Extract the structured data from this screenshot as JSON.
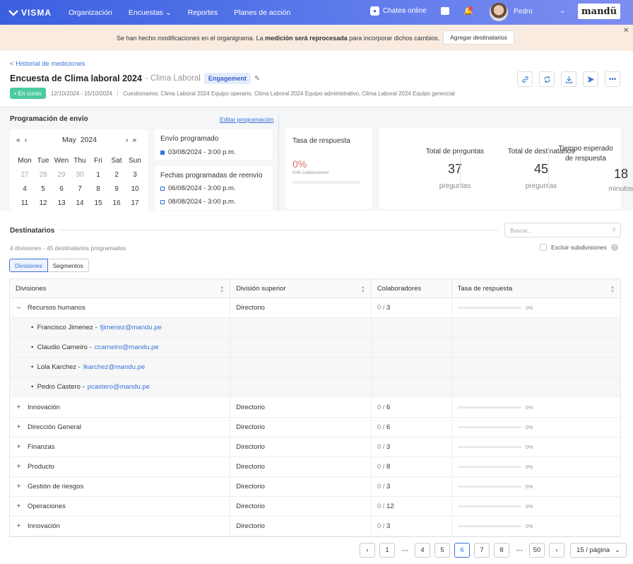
{
  "topbar": {
    "logo": "VISMA",
    "nav": [
      "Organización",
      "Encuestas",
      "Reportes",
      "Planes de acción"
    ],
    "chat_label": "Chatea online",
    "user_name": "Pedro",
    "brand": "mandü"
  },
  "banner": {
    "text_before": "Se han hecho modificaciones en el organigrama. La ",
    "text_bold": "medición será reprocesada",
    "text_after": " para incorporar dichos cambios.",
    "button": "Agregar destinatarios"
  },
  "header": {
    "back_link": "< Historial de mediciones",
    "title": "Encuesta de Clima laboral 2024",
    "subtitle": "- Clima Laboral",
    "tag": "Engagement",
    "status": "• En curso",
    "dates": "12/10/2024 - 15/10/2024",
    "cuestionarios": "Cuestionarios: Clima Laboral 2024 Equipo operario, Clima Laboral 2024 Equipo administrativo, Clima Laboral 2024 Equipo gerencial"
  },
  "programacion": {
    "title": "Programación de envío",
    "edit_link": "Editar programación",
    "calendar": {
      "month": "May",
      "year": "2024",
      "weekdays": [
        "Mon",
        "Tue",
        "Wen",
        "Thu",
        "Fri",
        "Sat",
        "Sun"
      ],
      "days": [
        {
          "d": "27",
          "muted": true
        },
        {
          "d": "28",
          "muted": true
        },
        {
          "d": "29",
          "muted": true
        },
        {
          "d": "30",
          "muted": true
        },
        {
          "d": "1"
        },
        {
          "d": "2"
        },
        {
          "d": "3"
        },
        {
          "d": "4"
        },
        {
          "d": "5"
        },
        {
          "d": "6"
        },
        {
          "d": "7"
        },
        {
          "d": "8"
        },
        {
          "d": "9"
        },
        {
          "d": "10"
        },
        {
          "d": "11"
        },
        {
          "d": "12"
        },
        {
          "d": "13"
        },
        {
          "d": "14"
        },
        {
          "d": "15"
        },
        {
          "d": "16"
        },
        {
          "d": "17"
        }
      ]
    },
    "envio_title": "Envío programado",
    "envio_date": "03/08/2024 - 3:00 p.m.",
    "reenvio_title": "Fechas programadas de reenvío",
    "reenvio_dates": [
      "06/08/2024 - 3:00 p.m.",
      "08/08/2024 - 3:00 p.m."
    ]
  },
  "tasa": {
    "title": "Tasa de respuesta",
    "pct": "0%",
    "sub": "0/45 colaboradores",
    "fill": 0
  },
  "stats": [
    {
      "label": "Total de preguntas",
      "num": "37",
      "unit": "preguntas"
    },
    {
      "label": "Total de destinatarios",
      "num": "45",
      "unit": "preguntas"
    },
    {
      "label": "Tiempo esperado de respuesta",
      "num": "18",
      "unit": "minutos"
    }
  ],
  "destinatarios": {
    "title": "Destinatarios",
    "search_placeholder": "Buscar...",
    "summary": "4 divisiones - 45 destinatarios programados",
    "exclude": "Excluir subdivisiones",
    "tabs": [
      "Divisiones",
      "Segmentos"
    ]
  },
  "table": {
    "headers": [
      "Divisiones",
      "División superior",
      "Colaboradores",
      "Tasa de respuesta"
    ],
    "rows": [
      {
        "type": "parent",
        "expanded": true,
        "name": "Recursos humanos",
        "parent": "Directorio",
        "done": "0",
        "total": "3",
        "pct": "0%",
        "fill": 0
      },
      {
        "type": "member",
        "name": "Francisco Jimenez",
        "email": "fjimenez@mandu.pe"
      },
      {
        "type": "member",
        "name": "Claudio Carneiro",
        "email": "ccarneiro@mandu.pe"
      },
      {
        "type": "member",
        "name": "Lola Karchez",
        "email": "lkarchez@mandu.pe"
      },
      {
        "type": "member",
        "name": "Pedro Castero",
        "email": "pcastero@mandu.pe"
      },
      {
        "type": "parent",
        "expanded": false,
        "name": "Innovación",
        "parent": "Directorio",
        "done": "0",
        "total": "6",
        "pct": "0%",
        "fill": 0
      },
      {
        "type": "parent",
        "expanded": false,
        "name": "Dirección General",
        "parent": "Directorio",
        "done": "0",
        "total": "6",
        "pct": "0%",
        "fill": 0
      },
      {
        "type": "parent",
        "expanded": false,
        "name": "Finanzas",
        "parent": "Directorio",
        "done": "0",
        "total": "3",
        "pct": "0%",
        "fill": 0
      },
      {
        "type": "parent",
        "expanded": false,
        "name": "Producto",
        "parent": "Directorio",
        "done": "0",
        "total": "8",
        "pct": "0%",
        "fill": 0
      },
      {
        "type": "parent",
        "expanded": false,
        "name": "Gestión de riesgos",
        "parent": "Directorio",
        "done": "0",
        "total": "3",
        "pct": "0%",
        "fill": 0
      },
      {
        "type": "parent",
        "expanded": false,
        "name": "Operaciones",
        "parent": "Directorio",
        "done": "0",
        "total": "12",
        "pct": "0%",
        "fill": 0
      },
      {
        "type": "parent",
        "expanded": false,
        "name": "Innovación",
        "parent": "Directorio",
        "done": "0",
        "total": "3",
        "pct": "0%",
        "fill": 0
      }
    ]
  },
  "pagination": {
    "pages": [
      "1",
      "4",
      "5",
      "6",
      "7",
      "8",
      "50"
    ],
    "current": "6",
    "per_page": "15 / página"
  },
  "colors": {
    "accent": "#3a73d8",
    "status": "#4ccaa0",
    "banner": "#f9ebe0",
    "tasa": "#e06c6c"
  }
}
